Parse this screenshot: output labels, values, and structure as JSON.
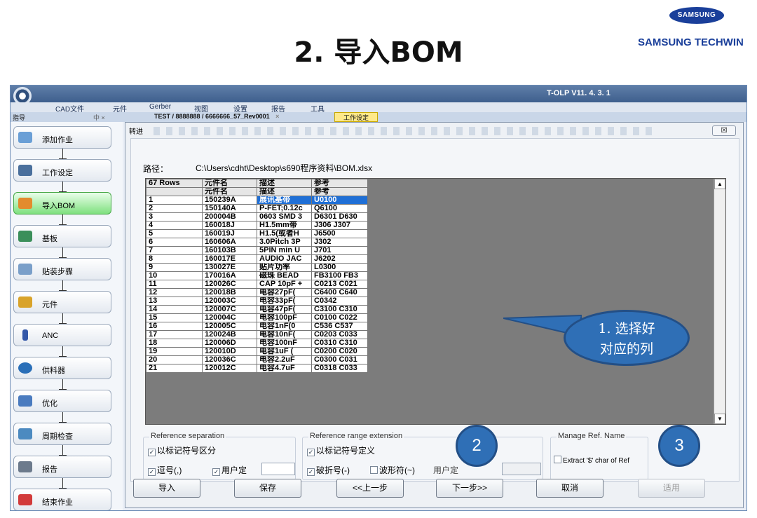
{
  "slide": {
    "title": "2. 导入BOM",
    "logo": "SAMSUNG",
    "brand": "SAMSUNG TECHWIN"
  },
  "app": {
    "title": "T-OLP V11. 4. 3. 1",
    "menu": [
      "CAD文件",
      "元件",
      "Gerber",
      "视图",
      "设置",
      "报告",
      "工具"
    ],
    "panel_title": "指导",
    "panel_controls": "中 ×",
    "doc_tab": "TEST / 8888888 / 6666666_57_Rev0001",
    "doc_tab_close": "×",
    "workspace_tab": "工作设定"
  },
  "sidebar": {
    "items": [
      {
        "label": "添加作业",
        "icon": "add-job-icon"
      },
      {
        "label": "工作设定",
        "icon": "work-settings-icon"
      },
      {
        "label": "导入BOM",
        "icon": "import-bom-icon"
      },
      {
        "label": "基板",
        "icon": "board-icon"
      },
      {
        "label": "贴装步骤",
        "icon": "mount-steps-icon"
      },
      {
        "label": "元件",
        "icon": "component-icon"
      },
      {
        "label": "ANC",
        "icon": "anc-icon"
      },
      {
        "label": "供料器",
        "icon": "feeder-icon"
      },
      {
        "label": "优化",
        "icon": "optimize-icon"
      },
      {
        "label": "周期检查",
        "icon": "cycle-check-icon"
      },
      {
        "label": "报告",
        "icon": "report-icon"
      },
      {
        "label": "结束作业",
        "icon": "end-job-icon"
      }
    ]
  },
  "dialog": {
    "title": "转进",
    "close": "☒",
    "path_label": "路径：",
    "path_value": "C:\\Users\\cdht\\Desktop\\s690程序资料\\BOM.xlsx",
    "grid": {
      "rows_label": "67 Rows",
      "headers": [
        "元件名",
        "描述",
        "参考"
      ],
      "subheaders": [
        "元件名",
        "描述",
        "参考"
      ],
      "rows": [
        [
          "1",
          "150239A",
          "展讯基带",
          "U0100"
        ],
        [
          "2",
          "150140A",
          "P-FET;0.12c",
          "Q6100"
        ],
        [
          "3",
          "200004B",
          "0603 SMD 3",
          "D6301 D630"
        ],
        [
          "4",
          "160018J",
          "H1.5mm带",
          "J306 J307"
        ],
        [
          "5",
          "160019J",
          "H1.5(或者H",
          "J6500"
        ],
        [
          "6",
          "160606A",
          "3.0Pitch 3P",
          "J302"
        ],
        [
          "7",
          "160103B",
          "5PIN min U",
          "J701"
        ],
        [
          "8",
          "160017E",
          "AUDIO JAC",
          "J6202"
        ],
        [
          "9",
          "130027E",
          "贴片功率",
          "L0300"
        ],
        [
          "10",
          "170016A",
          "磁珠 BEAD",
          "FB3100 FB3"
        ],
        [
          "11",
          "120026C",
          "CAP 10pF +",
          "C0213 C021"
        ],
        [
          "12",
          "120018B",
          "电容27pF(",
          "C6400 C640"
        ],
        [
          "13",
          "120003C",
          "电容33pF(",
          "C0342"
        ],
        [
          "14",
          "120007C",
          "电容47pF(",
          "C3100 C310"
        ],
        [
          "15",
          "120004C",
          "电容100pF",
          "C0100 C022"
        ],
        [
          "16",
          "120005C",
          "电容1nF(0",
          "C536 C537"
        ],
        [
          "17",
          "120024B",
          "电容10nF(",
          "C0203 C033"
        ],
        [
          "18",
          "120006D",
          "电容100nF",
          "C0310 C310"
        ],
        [
          "19",
          "120010D",
          "电容1uF (",
          "C0200 C020"
        ],
        [
          "20",
          "120036C",
          "电容2.2uF",
          "C0300 C031"
        ],
        [
          "21",
          "120012C",
          "电容4.7uF",
          "C0318 C033"
        ]
      ],
      "scroll_up": "▲",
      "scroll_down": "▼"
    },
    "callout": {
      "line1": "1. 选择好",
      "line2": "对应的列"
    },
    "groups": {
      "separation": {
        "title": "Reference separation",
        "opt1": "以标记符号区分",
        "opt2": "逗号(,)",
        "opt3": "用户定"
      },
      "range": {
        "title": "Reference range extension",
        "opt1": "以标记符号定义",
        "opt2": "破折号(-)",
        "opt3": "波形符(~)",
        "opt4": "用户定"
      },
      "manage": {
        "title": "Manage Ref. Name",
        "opt1": "Extract '$' char of Ref"
      }
    },
    "checkbox_states": {
      "sep1": true,
      "sep2": true,
      "sep3": true,
      "range1": true,
      "range2": true,
      "range3": false,
      "manage1": false
    },
    "markers": {
      "two": "2",
      "three": "3"
    },
    "buttons": {
      "import": "导入",
      "save": "保存",
      "prev": "<<上一步",
      "next": "下一步>>",
      "cancel": "取消",
      "apply": "适用"
    }
  },
  "colors": {
    "selected_cell": "#1f6fd6",
    "callout": "#2f6fb6",
    "active_step": "#7ee07e",
    "brand": "#1a3f9a"
  }
}
